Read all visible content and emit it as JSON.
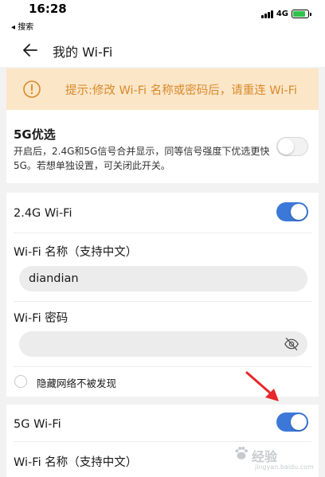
{
  "status_bar": {
    "time": "16:28",
    "back_label": "◂ 搜索",
    "network": "4G",
    "battery_level": 0.85,
    "battery_color": "#2fc34b"
  },
  "nav": {
    "back_icon": "arrow-left-icon",
    "title": "我的 Wi-Fi"
  },
  "notice": {
    "icon": "warning-circle-icon",
    "text": "提示:修改 Wi-Fi 名称或密码后，请重连 Wi-Fi",
    "color": "#d98a2b",
    "background": "#fbe6c8"
  },
  "preferred_5g": {
    "title": "5G优选",
    "description": "开启后，2.4G和5G信号合并显示，同等信号强度下优选更快5G。若想单独设置，可关闭此开关。",
    "enabled": false
  },
  "band_24g": {
    "title": "2.4G Wi-Fi",
    "enabled": true,
    "name_label": "Wi-Fi 名称（支持中文）",
    "name_value": "diandian",
    "password_label": "Wi-Fi 密码",
    "password_value": "",
    "password_icon": "eye-hidden-icon",
    "hide_network_label": "隐藏网络不被发现",
    "hide_network_checked": false
  },
  "band_5g": {
    "title": "5G Wi-Fi",
    "enabled": true,
    "name_label": "Wi-Fi 名称（支持中文）"
  },
  "annotation": {
    "arrow_color": "#e8262b",
    "arrow_icon": "red-arrow-icon"
  },
  "watermark": {
    "icon": "baidu-paw-icon",
    "text": "经验",
    "sub": "jingyan.baidu.com"
  },
  "colors": {
    "toggle_on": "#3c78d8",
    "page_background": "#f2f2f2"
  }
}
